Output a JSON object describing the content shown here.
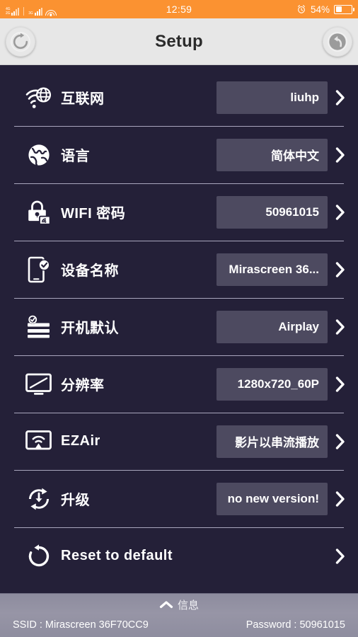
{
  "statusbar": {
    "sim1_net_top": "4G",
    "sim1_net_bottom": "2G",
    "sim2_net": "3G",
    "wifi_icon": "wifi-icon",
    "clock": "12:59",
    "alarm_icon": "alarm-clock-icon",
    "battery_percent": "54%",
    "battery_icon": "battery-icon",
    "battery_fill_pct": 40,
    "background_color": "#fb9231"
  },
  "header": {
    "title": "Setup",
    "refresh_icon": "refresh-icon",
    "back_icon": "undo-back-icon",
    "background_color": "#e7e7e7"
  },
  "theme": {
    "page_background": "#242038",
    "value_chip": "#4d4a60",
    "divider": "#a9a6bd",
    "text": "#ffffff"
  },
  "settings": {
    "rows": [
      {
        "icon": "wifi-globe-icon",
        "label": "互联网",
        "value": "liuhp",
        "has_value": true,
        "chevron": "chevron-right-icon"
      },
      {
        "icon": "globe-icon",
        "label": "语言",
        "value": "简体中文",
        "has_value": true,
        "chevron": "chevron-right-icon"
      },
      {
        "icon": "lock-wifi-icon",
        "label": "WIFI 密码",
        "value": "50961015",
        "has_value": true,
        "chevron": "chevron-right-icon"
      },
      {
        "icon": "device-check-icon",
        "label": "设备名称",
        "value": "Mirascreen 36...",
        "has_value": true,
        "chevron": "chevron-right-icon"
      },
      {
        "icon": "list-check-icon",
        "label": "开机默认",
        "value": "Airplay",
        "has_value": true,
        "chevron": "chevron-right-icon"
      },
      {
        "icon": "monitor-icon",
        "label": "分辨率",
        "value": "1280x720_60P",
        "has_value": true,
        "chevron": "chevron-right-icon"
      },
      {
        "icon": "airplay-icon",
        "label": "EZAir",
        "value": "影片以串流播放",
        "has_value": true,
        "chevron": "chevron-right-icon"
      },
      {
        "icon": "upgrade-icon",
        "label": "升级",
        "value": "no new version!",
        "has_value": true,
        "chevron": "chevron-right-icon"
      },
      {
        "icon": "reset-icon",
        "label": "Reset to default",
        "value": "",
        "has_value": false,
        "chevron": "chevron-right-icon"
      }
    ]
  },
  "bottom": {
    "caret_icon": "caret-up-icon",
    "info_label": "信息",
    "ssid_text": "SSID : Mirascreen 36F70CC9",
    "password_text": "Password : 50961015"
  }
}
